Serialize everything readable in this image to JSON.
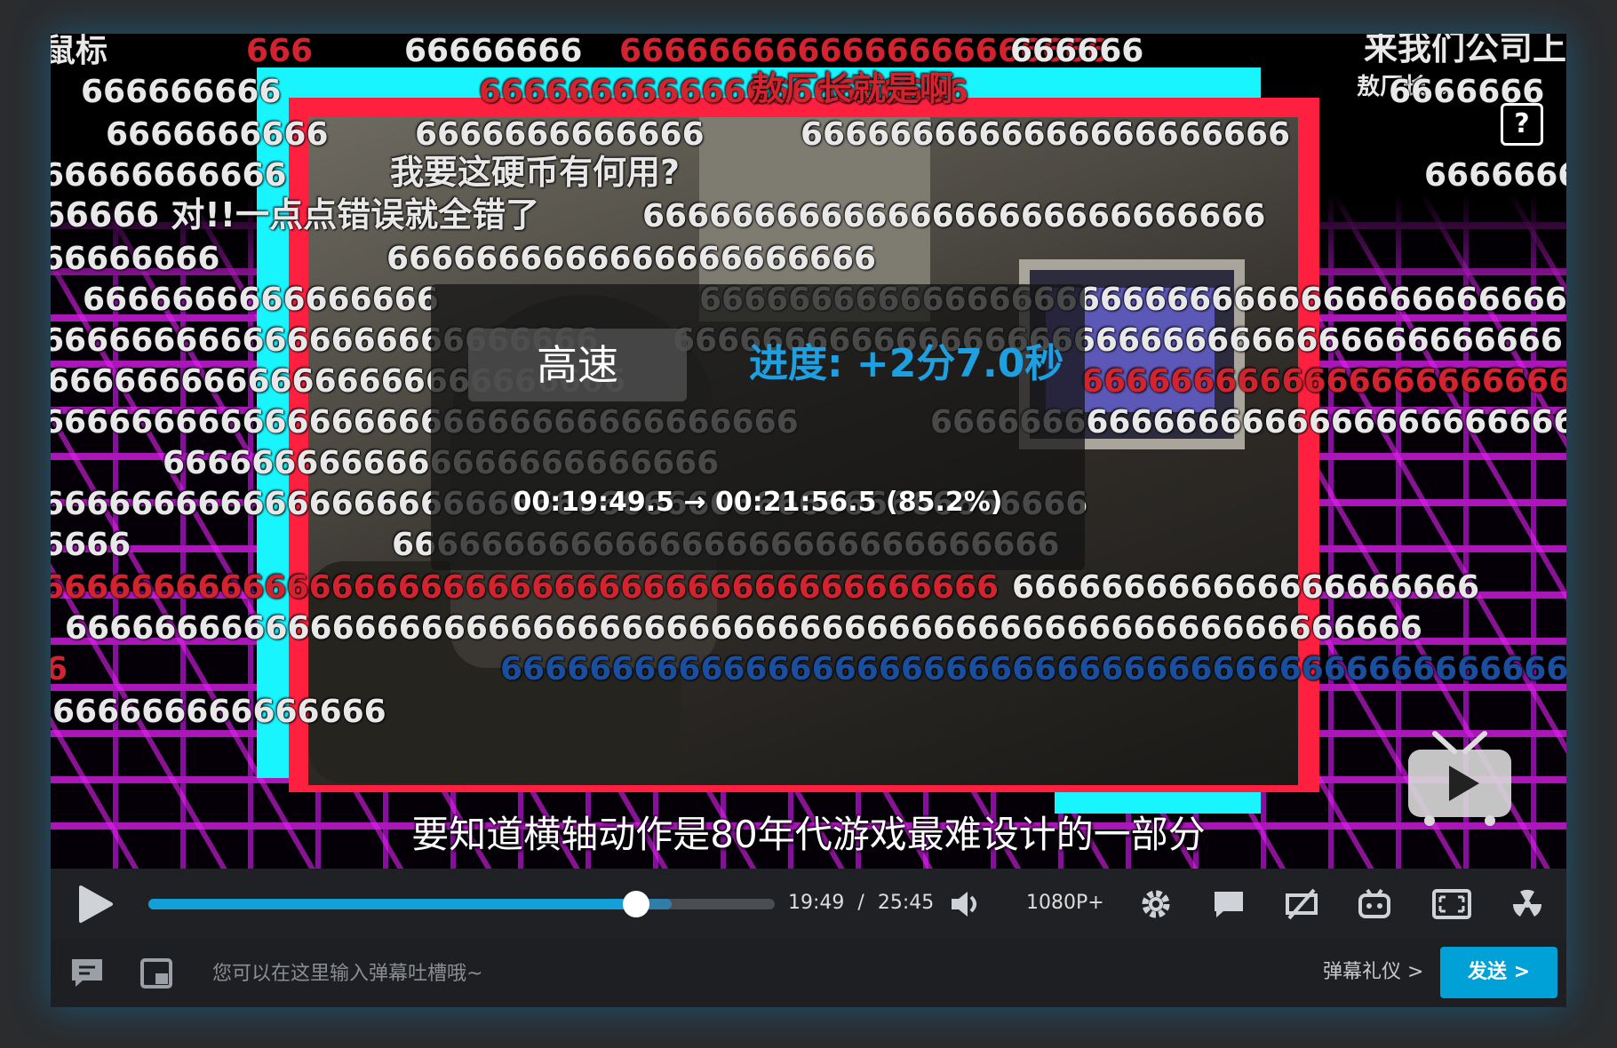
{
  "danmaku": [
    {
      "text": "鼠标",
      "color": "white"
    },
    {
      "text": "666",
      "color": "red"
    },
    {
      "text": "66666666",
      "color": "white"
    },
    {
      "text": "6666666666666666666666",
      "color": "red"
    },
    {
      "text": "666666",
      "color": "white"
    },
    {
      "text": "来我们公司上",
      "color": "white"
    },
    {
      "text": "666666666",
      "color": "white"
    },
    {
      "text": "6666666666666666666666",
      "color": "red"
    },
    {
      "text": "敖厂长就是啊",
      "color": "red"
    },
    {
      "text": "敖厂长 ⌄",
      "color": "white"
    },
    {
      "text": "6666666",
      "color": "white"
    },
    {
      "text": "6666666666",
      "color": "white"
    },
    {
      "text": "6666666666666",
      "color": "white"
    },
    {
      "text": "6666666666666666666666",
      "color": "white"
    },
    {
      "text": "66666666666",
      "color": "white"
    },
    {
      "text": "我要这硬币有何用?",
      "color": "white"
    },
    {
      "text": "6666666",
      "color": "white"
    },
    {
      "text": "66666 对!!一点点错误就全错了",
      "color": "white"
    },
    {
      "text": "6666666666666666666666666666",
      "color": "white"
    },
    {
      "text": "66666666",
      "color": "white"
    },
    {
      "text": "6666666666666666666666",
      "color": "white"
    },
    {
      "text": "6666666666666666",
      "color": "white"
    },
    {
      "text": "66666666666666666666666666666666666666666",
      "color": "white"
    },
    {
      "text": "6666666666666666666666666",
      "color": "white"
    },
    {
      "text": "6666666666666666666666666666666666666666",
      "color": "white"
    },
    {
      "text": "66666666666666666666666666",
      "color": "white"
    },
    {
      "text": "666666666666666666666666666666",
      "color": "red"
    },
    {
      "text": "6666666666666666666666666666666666",
      "color": "white"
    },
    {
      "text": "6666666666666666666666666666666",
      "color": "white"
    },
    {
      "text": "6666666666666666666666666",
      "color": "white"
    },
    {
      "text": "66666666666666666666666666666666666666666666666",
      "color": "white"
    },
    {
      "text": "6666",
      "color": "white"
    },
    {
      "text": "666666666666666666666666666666",
      "color": "white"
    },
    {
      "text": "6666666666666666666666666666666666666666666",
      "color": "red"
    },
    {
      "text": "666666666666666666666",
      "color": "white"
    },
    {
      "text": "6666666666666666666666666666666666666666666666666666666666666",
      "color": "white"
    },
    {
      "text": "6",
      "color": "red"
    },
    {
      "text": "6666666666666666666666666666666666666666666666666666",
      "color": "blue"
    },
    {
      "text": "666666666666666",
      "color": "white"
    }
  ],
  "seek_overlay": {
    "speed_label": "高速",
    "progress_label": "进度: +2分7.0秒",
    "time_range": "00:19:49.5 → 00:21:56.5 (85.2%)"
  },
  "subtitle": "要知道横轴动作是80年代游戏最难设计的一部分",
  "controls": {
    "current_time": "19:49",
    "time_separator": "/",
    "duration": "25:45",
    "quality": "1080P+",
    "progress_fraction": 0.779,
    "buffered_fraction": 0.835
  },
  "danmaku_bar": {
    "placeholder": "您可以在这里输入弹幕吐槽哦~",
    "etiquette_label": "弹幕礼仪 >",
    "send_label": "发送 >"
  },
  "colors": {
    "accent": "#00a1d6",
    "progress_fill": "#12a0d8",
    "neon_cyan": "#19f5ff",
    "neon_red": "#ff2040",
    "grid_magenta": "#c81ad8"
  },
  "icons": [
    "play-icon",
    "volume-icon",
    "settings-gear-icon",
    "danmaku-bubble-icon",
    "danmaku-off-icon",
    "bilibili-tv-icon",
    "fullscreen-icon",
    "radiation-icon",
    "danmaku-list-icon",
    "picture-in-picture-icon",
    "qr-scan-icon"
  ]
}
